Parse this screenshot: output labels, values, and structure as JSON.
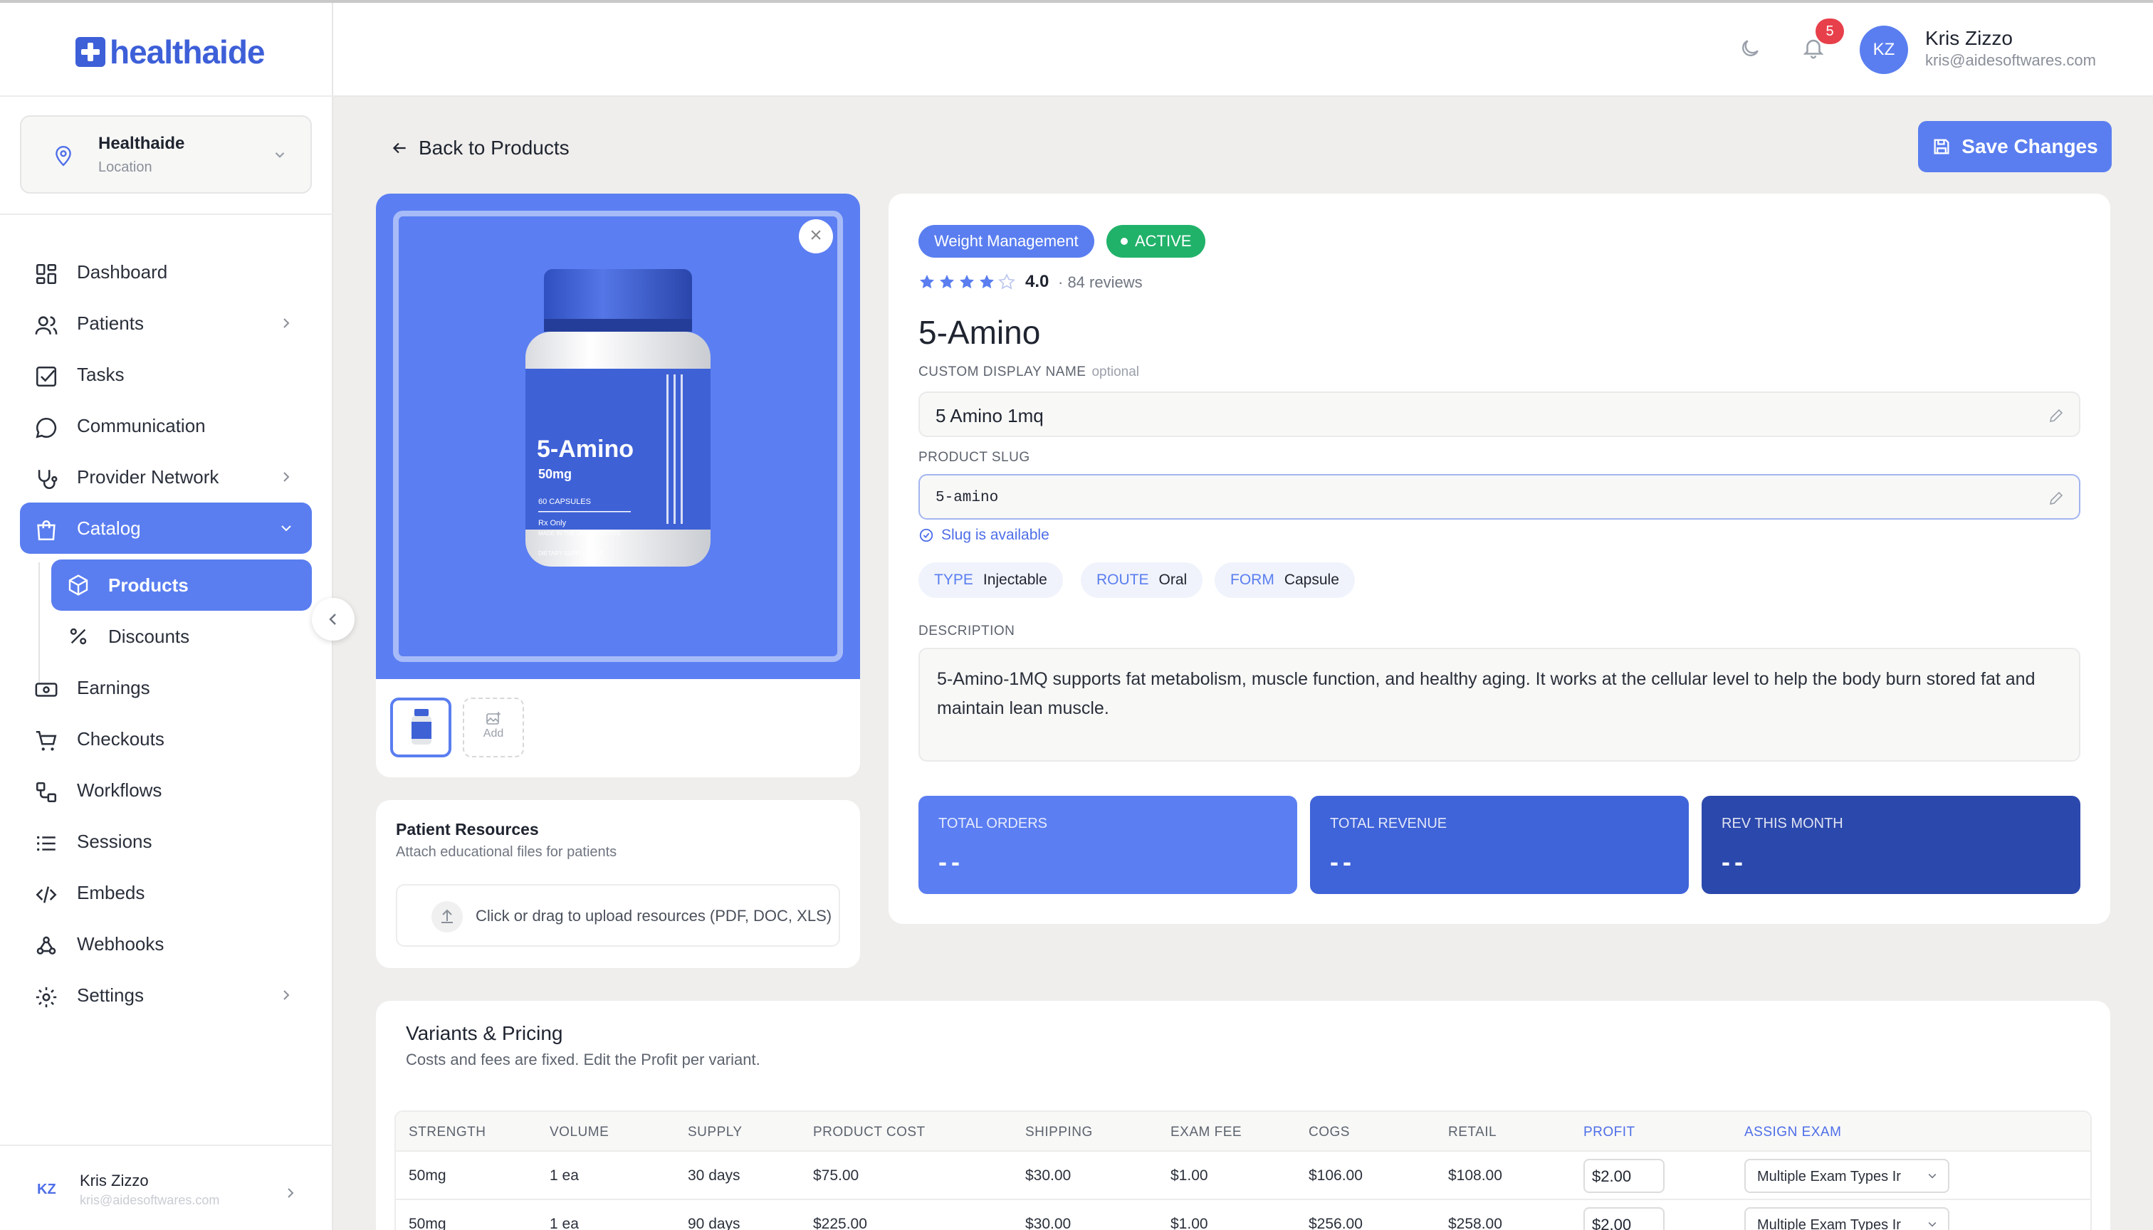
{
  "brand": {
    "logo_text": "healthaide"
  },
  "location": {
    "name": "Healthaide",
    "label": "Location"
  },
  "nav": {
    "dashboard": "Dashboard",
    "patients": "Patients",
    "tasks": "Tasks",
    "communication": "Communication",
    "provider_network": "Provider Network",
    "catalog": "Catalog",
    "products": "Products",
    "discounts": "Discounts",
    "earnings": "Earnings",
    "checkouts": "Checkouts",
    "workflows": "Workflows",
    "sessions": "Sessions",
    "embeds": "Embeds",
    "webhooks": "Webhooks",
    "settings": "Settings"
  },
  "sidebar_user": {
    "initials": "KZ",
    "name": "Kris Zizzo",
    "email": "kris@aidesoftwares.com"
  },
  "topbar": {
    "notification_count": "5",
    "user_initials": "KZ",
    "user_name": "Kris Zizzo",
    "user_email": "kris@aidesoftwares.com"
  },
  "page": {
    "back_label": "Back to Products",
    "save_label": "Save Changes"
  },
  "product_image": {
    "label_name": "5-Amino",
    "label_dose": "50mg",
    "label_capsules": "60 CAPSULES",
    "label_rx": "Rx Only",
    "label_made": "MADE IN THE UNITED STATES",
    "label_type": "DIETARY SUPPLEMENT",
    "add_label": "Add",
    "close_glyph": "×"
  },
  "resources": {
    "title": "Patient Resources",
    "subtitle": "Attach educational files for patients",
    "upload_text": "Click or drag to upload resources (PDF, DOC, XLS)"
  },
  "product": {
    "category": "Weight Management",
    "status": "ACTIVE",
    "rating": 4.0,
    "rating_text": "4.0",
    "reviews_text": "· 84 reviews",
    "name": "5-Amino",
    "custom_name_label": "CUSTOM DISPLAY NAME",
    "custom_name_optional": "optional",
    "custom_name_value": "5 Amino 1mq",
    "slug_label": "PRODUCT SLUG",
    "slug_value": "5-amino",
    "slug_status": "Slug is available",
    "attributes": [
      {
        "key": "TYPE",
        "value": "Injectable"
      },
      {
        "key": "ROUTE",
        "value": "Oral"
      },
      {
        "key": "FORM",
        "value": "Capsule"
      }
    ],
    "description_label": "DESCRIPTION",
    "description": "5-Amino-1MQ supports fat metabolism, muscle function, and healthy aging. It works at the cellular level to help the body burn stored fat and maintain lean muscle."
  },
  "stats": [
    {
      "label": "TOTAL ORDERS",
      "value": "--",
      "color": "#5b7ef2"
    },
    {
      "label": "TOTAL REVENUE",
      "value": "--",
      "color": "#3f63d8"
    },
    {
      "label": "REV THIS MONTH",
      "value": "--",
      "color": "#2b48ac"
    }
  ],
  "variants": {
    "title": "Variants & Pricing",
    "subtitle": "Costs and fees are fixed. Edit the Profit per variant.",
    "columns": [
      "STRENGTH",
      "VOLUME",
      "SUPPLY",
      "PRODUCT COST",
      "SHIPPING",
      "EXAM FEE",
      "COGS",
      "RETAIL",
      "PROFIT",
      "ASSIGN EXAM"
    ],
    "rows": [
      {
        "strength": "50mg",
        "volume": "1 ea",
        "supply": "30 days",
        "product_cost": "$75.00",
        "shipping": "$30.00",
        "exam_fee": "$1.00",
        "cogs": "$106.00",
        "retail": "$108.00",
        "profit": "$2.00",
        "exam": "Multiple Exam Types Ir"
      },
      {
        "strength": "50mg",
        "volume": "1 ea",
        "supply": "90 days",
        "product_cost": "$225.00",
        "shipping": "$30.00",
        "exam_fee": "$1.00",
        "cogs": "$256.00",
        "retail": "$258.00",
        "profit": "$2.00",
        "exam": "Multiple Exam Types Ir"
      }
    ]
  },
  "colors": {
    "accent": "#5a7ef0",
    "active_status": "#21b26a",
    "badge": "#e7404b"
  }
}
